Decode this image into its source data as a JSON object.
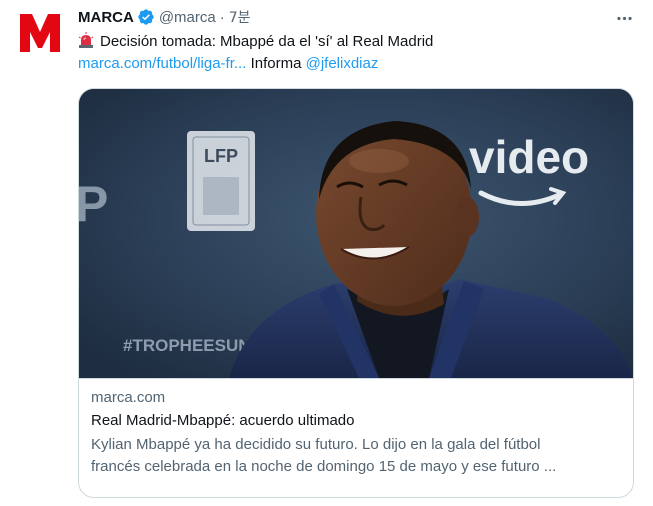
{
  "tweet": {
    "author_name": "MARCA",
    "handle": "@marca",
    "separator": "·",
    "time": "7분",
    "text_line1": "Decisión tomada: Mbappé da el 'sí' al Real Madrid",
    "link_text": "marca.com/futbol/liga-fr...",
    "informa": " Informa ",
    "mention": "@jfelixdiaz"
  },
  "card": {
    "domain": "marca.com",
    "title": "Real Madrid-Mbappé: acuerdo ultimado",
    "desc_line1": "Kylian Mbappé ya ha decidido su futuro. Lo dijo en la gala del fútbol",
    "desc_line2": "francés celebrada en la noche de domingo 15 de mayo y ese futuro ...",
    "image_texts": {
      "lfp": "LFP",
      "video": "video",
      "tag": "#TROPHEESUNFP",
      "p": "P"
    }
  },
  "icons": {
    "avatar": "marca-logo",
    "verified": "verified-badge-icon",
    "siren": "siren-emoji",
    "more": "more-options-icon"
  },
  "colors": {
    "link": "#1d9bf0",
    "verified": "#1d9bf0",
    "marca_red": "#e30613",
    "muted": "#536471"
  }
}
